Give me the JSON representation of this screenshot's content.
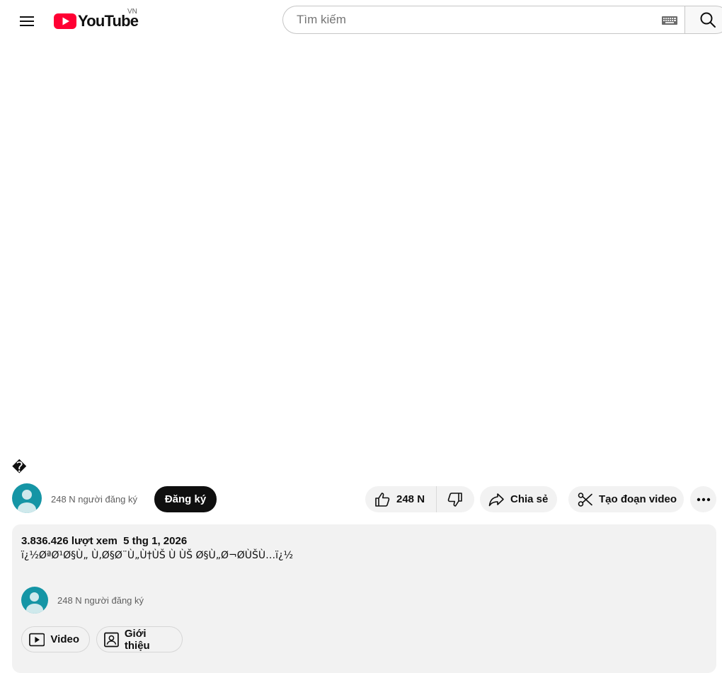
{
  "masthead": {
    "logo_text": "YouTube",
    "country_code": "VN",
    "search_placeholder": "Tìm kiếm",
    "icons": {
      "menu": "hamburger-menu-icon",
      "keyboard": "keyboard-icon",
      "search": "search-icon",
      "logo": "youtube-play-icon"
    }
  },
  "colors": {
    "brand_red": "#ff0033",
    "avatar": "#1595a5",
    "subscribe_bg": "#0f0f0f",
    "pill_bg": "#f2f2f2"
  },
  "video": {
    "title": "�",
    "channel": {
      "subscribers": "248 N người đăng ký"
    },
    "subscribe_label": "Đăng ký",
    "actions": {
      "like_count": "248 N",
      "share_label": "Chia sẻ",
      "clip_label": "Tạo đoạn video"
    }
  },
  "description": {
    "views": "3.836.426 lượt xem",
    "date": "5 thg 1, 2026",
    "text": "ï¿½ØªØ¹Ø§Ù„ Ù‚Ø§Ø¨Ù„Ù†ÙŠ Ù  ÙŠ Ø§Ù„Ø¬ØÙŠÙ…ï¿½",
    "channel_subscribers": "248 N người đăng ký",
    "chips": {
      "videos": "Video",
      "about": "Giới thiệu"
    }
  }
}
